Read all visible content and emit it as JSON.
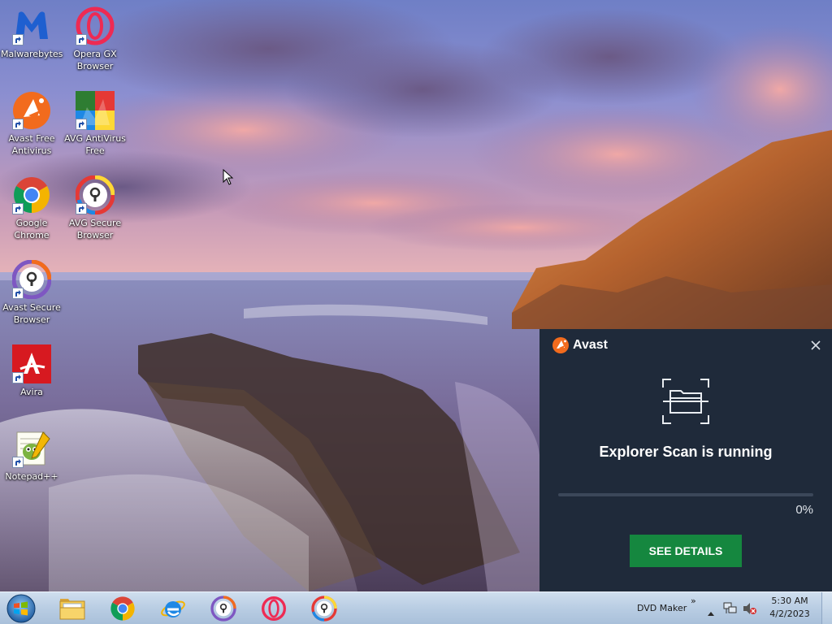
{
  "desktop": {
    "icons": [
      {
        "label": "Malwarebytes",
        "icon": "malwarebytes-icon"
      },
      {
        "label": "Opera GX Browser",
        "icon": "opera-gx-icon"
      },
      {
        "label": "Avast Free Antivirus",
        "icon": "avast-antivirus-icon"
      },
      {
        "label": "AVG AntiVirus Free",
        "icon": "avg-antivirus-icon"
      },
      {
        "label": "Google Chrome",
        "icon": "chrome-icon"
      },
      {
        "label": "AVG Secure Browser",
        "icon": "avg-secure-browser-icon"
      },
      {
        "label": "Avast Secure Browser",
        "icon": "avast-secure-browser-icon"
      },
      {
        "label": "Avira",
        "icon": "avira-icon"
      },
      {
        "label": "Notepad++",
        "icon": "notepadpp-icon"
      }
    ]
  },
  "popup": {
    "brand": "Avast",
    "title": "Explorer Scan is running",
    "progress": 0,
    "progress_label": "0%",
    "button_label": "SEE DETAILS",
    "close_icon": "close-icon",
    "graphic_icon": "folder-scan-icon",
    "colors": {
      "background": "#1f2a3a",
      "button": "#15873f",
      "brand": "#f26b1d"
    }
  },
  "taskbar": {
    "start_icon": "windows-start-icon",
    "apps": [
      "file-explorer-icon",
      "chrome-icon",
      "internet-explorer-icon",
      "avast-secure-browser-icon",
      "opera-icon",
      "avg-secure-browser-icon"
    ],
    "toolbar_label": "DVD Maker",
    "toolbar_chevron": "»",
    "tray_icons": [
      "show-hidden-icons-icon",
      "network-icon",
      "volume-muted-icon"
    ],
    "time": "5:30 AM",
    "date": "4/2/2023"
  }
}
